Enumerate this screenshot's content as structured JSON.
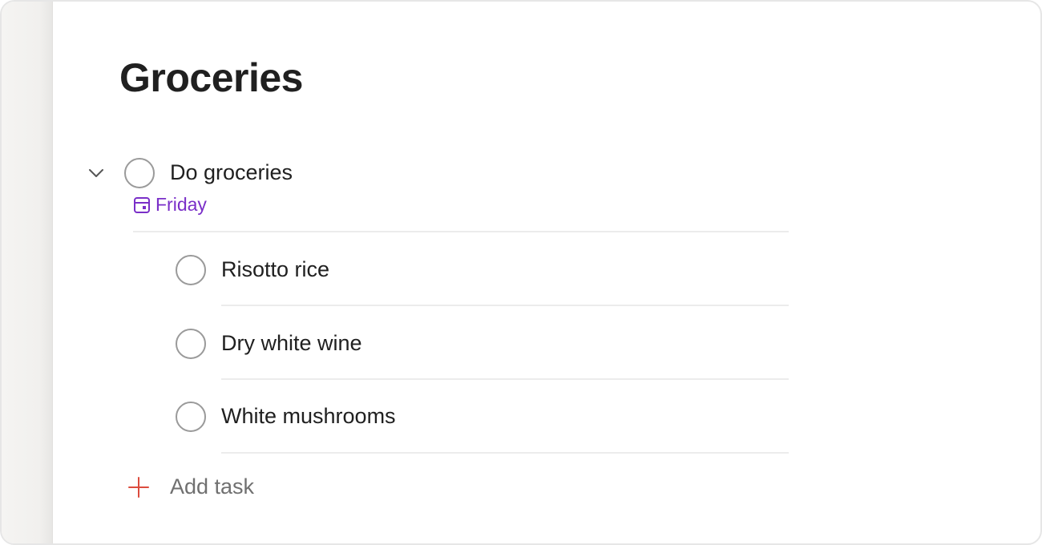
{
  "project": {
    "title": "Groceries"
  },
  "parent_task": {
    "label": "Do groceries",
    "due": "Friday",
    "icons": {
      "collapse": "chevron-down-icon",
      "due": "calendar-icon"
    },
    "due_color": "#7a2fc8"
  },
  "subtasks": [
    {
      "label": "Risotto rice"
    },
    {
      "label": "Dry white wine"
    },
    {
      "label": "White mushrooms"
    }
  ],
  "add_task": {
    "label": "Add task",
    "icon": "plus-icon",
    "icon_color": "#dc4c3e"
  }
}
